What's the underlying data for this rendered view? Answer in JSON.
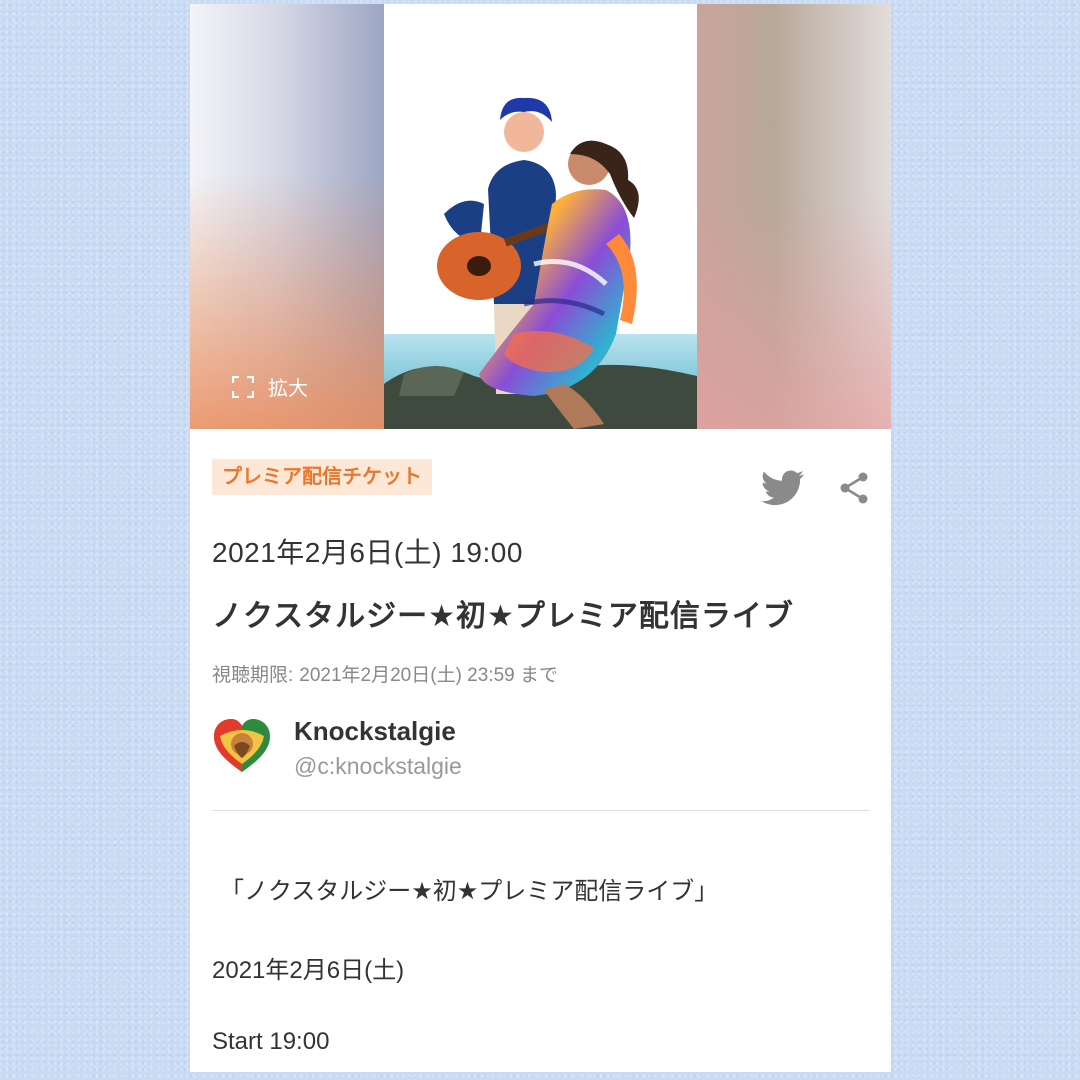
{
  "hero": {
    "zoom_label": "拡大"
  },
  "ticket": {
    "badge": "プレミア配信チケット",
    "datetime": "2021年2月6日(土) 19:00",
    "title": "ノクスタルジー★初★プレミア配信ライブ",
    "deadline_label": "視聴期限:",
    "deadline_value": "2021年2月20日(土) 23:59 まで"
  },
  "share": {
    "icons": [
      "twitter-icon",
      "share-icon"
    ]
  },
  "organizer": {
    "name": "Knockstalgie",
    "handle": "@c:knockstalgie"
  },
  "description": {
    "quote_line": "「ノクスタルジー★初★プレミア配信ライブ」",
    "date_line": "2021年2月6日(土)",
    "start_line": "Start 19:00"
  },
  "colors": {
    "page_background": "#c9dbf3",
    "badge_background": "#fde7d6",
    "badge_text": "#e8782f",
    "icon_gray": "#8a8a8a",
    "primary_text": "#333333",
    "secondary_text": "#888888"
  }
}
